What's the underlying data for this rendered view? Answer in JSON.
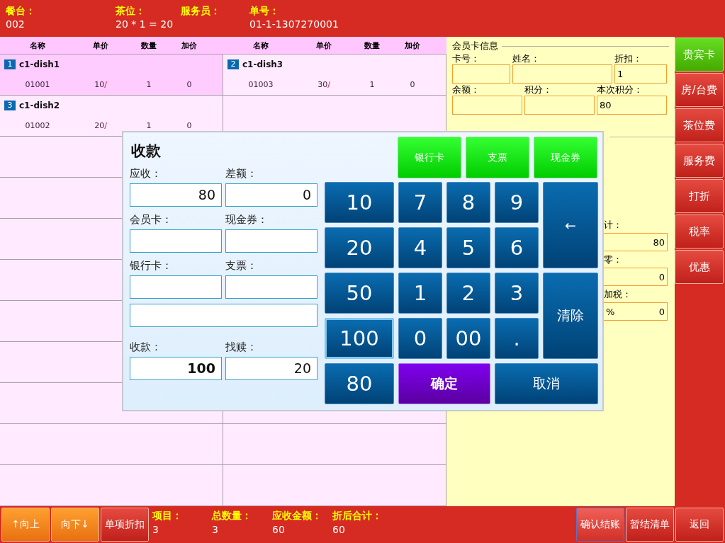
{
  "header": [
    {
      "label": "餐台：",
      "value": "002"
    },
    {
      "label": "茶位：",
      "value": "20 * 1 = 20"
    },
    {
      "label": "服务员："
    },
    {
      "label": "单号：",
      "value": "01-1-1307270001"
    }
  ],
  "order_grid": {
    "columns": [
      "名称",
      "单价",
      "数量",
      "加价",
      "名称",
      "单价",
      "数量",
      "加价"
    ],
    "items": [
      {
        "index": "1",
        "name": "c1-dish1",
        "code": "01001",
        "price": "10",
        "price_mark": "/",
        "quantity": "1",
        "surcharge": "0",
        "selected": true
      },
      {
        "index": "2",
        "name": "c1-dish3",
        "code": "01003",
        "price": "30",
        "price_mark": "/",
        "quantity": "1",
        "surcharge": "0",
        "selected": false
      },
      {
        "index": "3",
        "name": "c1-dish2",
        "code": "01002",
        "price": "20",
        "price_mark": "/",
        "quantity": "1",
        "surcharge": "0",
        "selected": false
      }
    ]
  },
  "member_card": {
    "title": "会员卡信息",
    "fields": [
      {
        "label": "卡号："
      },
      {
        "label": "姓名："
      },
      {
        "label": "折扣：",
        "value": "1"
      },
      {
        "label": "余额："
      },
      {
        "label": "积分："
      },
      {
        "label": "本次积分：",
        "value": "80"
      }
    ]
  },
  "totals_panel": {
    "fields": [
      {
        "label": "计：",
        "value": "80"
      },
      {
        "label": "零：",
        "value": "0"
      },
      {
        "label": "加税：",
        "prefix": "%",
        "value": "0"
      }
    ]
  },
  "side_buttons": [
    {
      "label": "贵宾卡",
      "kind": "vip"
    },
    {
      "label": "房/台费",
      "kind": "fee"
    },
    {
      "label": "茶位费",
      "kind": "fee"
    },
    {
      "label": "服务费",
      "kind": "fee"
    },
    {
      "label": "打折",
      "kind": "fee"
    },
    {
      "label": "税率",
      "kind": "fee"
    },
    {
      "label": "优惠",
      "kind": "fee"
    }
  ],
  "payment_dialog": {
    "title": "收款",
    "fields": [
      {
        "kind": "labeled",
        "label": "应收：",
        "value": "80"
      },
      {
        "kind": "labeled",
        "label": "差额：",
        "value": "0"
      },
      {
        "kind": "labeled",
        "label": "会员卡："
      },
      {
        "kind": "labeled",
        "label": "现金券："
      },
      {
        "kind": "labeled",
        "label": "银行卡："
      },
      {
        "kind": "labeled",
        "label": "支票："
      },
      {
        "kind": "blank"
      },
      {
        "kind": "labeled",
        "label": "收款：",
        "value": "100",
        "bold": true
      },
      {
        "kind": "labeled",
        "label": "找赎：",
        "value": "20"
      }
    ],
    "method_buttons": [
      "银行卡",
      "支票",
      "现金券"
    ],
    "keypad": [
      {
        "label": "10",
        "kind": "quick",
        "selected": false
      },
      {
        "label": "7",
        "kind": "digit",
        "selected": false
      },
      {
        "label": "8",
        "kind": "digit",
        "selected": false
      },
      {
        "label": "9",
        "kind": "digit",
        "selected": false
      },
      {
        "label": "←",
        "kind": "back",
        "selected": false
      },
      {
        "label": "20",
        "kind": "quick",
        "selected": false
      },
      {
        "label": "4",
        "kind": "digit",
        "selected": false
      },
      {
        "label": "5",
        "kind": "digit",
        "selected": false
      },
      {
        "label": "6",
        "kind": "digit",
        "selected": false
      },
      {
        "label": "50",
        "kind": "quick",
        "selected": false
      },
      {
        "label": "1",
        "kind": "digit",
        "selected": false
      },
      {
        "label": "2",
        "kind": "digit",
        "selected": false
      },
      {
        "label": "3",
        "kind": "digit",
        "selected": false
      },
      {
        "label": "清除",
        "kind": "clear",
        "selected": false
      },
      {
        "label": "100",
        "kind": "quick",
        "selected": true
      },
      {
        "label": "0",
        "kind": "digit",
        "selected": false
      },
      {
        "label": "00",
        "kind": "digit",
        "selected": false
      },
      {
        "label": ".",
        "kind": "digit",
        "selected": false
      },
      {
        "label": "80",
        "kind": "quick",
        "selected": false
      },
      {
        "label": "确定",
        "kind": "ok",
        "selected": false
      },
      {
        "label": "取消",
        "kind": "cancel",
        "selected": false
      }
    ]
  },
  "footer": {
    "buttons": [
      {
        "label": "↑向上",
        "kind": "nav"
      },
      {
        "label": "向下↓",
        "kind": "nav"
      },
      {
        "label": "单项折扣",
        "kind": "action"
      }
    ],
    "summary": [
      {
        "label": "项目：",
        "value": "3"
      },
      {
        "label": "总数量：",
        "value": "3"
      },
      {
        "label": "应收金额：",
        "value": "60"
      },
      {
        "label": "折后合计：",
        "value": "60"
      }
    ],
    "actions": [
      {
        "label": "确认结账",
        "selected": true
      },
      {
        "label": "暂结清单",
        "selected": false
      },
      {
        "label": "返回",
        "selected": false
      }
    ]
  }
}
